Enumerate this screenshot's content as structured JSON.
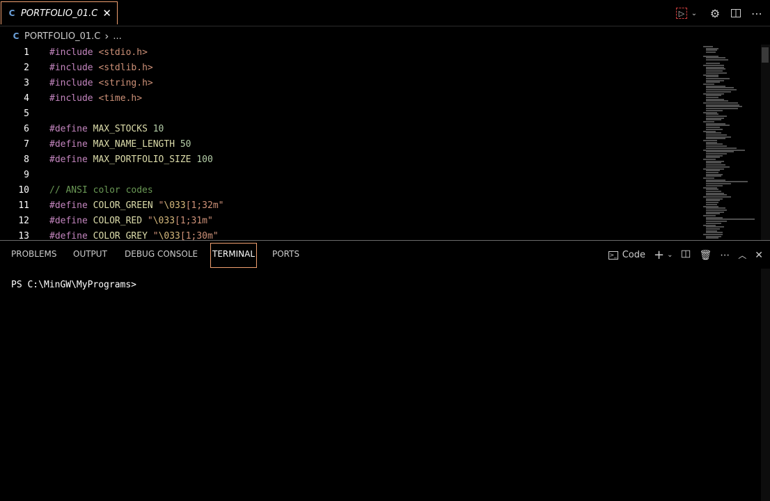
{
  "tab": {
    "icon": "c-language-icon",
    "label": "PORTFOLIO_01.C",
    "close": "✕"
  },
  "top_actions": [
    "run-icon",
    "chevron-down-icon",
    "gear-icon",
    "split-editor-icon",
    "more-icon"
  ],
  "breadcrumb": {
    "file": "PORTFOLIO_01.C",
    "sep": "›",
    "rest": "..."
  },
  "editor": {
    "lines": [
      {
        "n": "1",
        "parts": [
          [
            "kw",
            "#include"
          ],
          [
            "plain",
            " "
          ],
          [
            "inc",
            "<stdio.h>"
          ]
        ]
      },
      {
        "n": "2",
        "parts": [
          [
            "kw",
            "#include"
          ],
          [
            "plain",
            " "
          ],
          [
            "inc",
            "<stdlib.h>"
          ]
        ]
      },
      {
        "n": "3",
        "parts": [
          [
            "kw",
            "#include"
          ],
          [
            "plain",
            " "
          ],
          [
            "inc",
            "<string.h>"
          ]
        ]
      },
      {
        "n": "4",
        "parts": [
          [
            "kw",
            "#include"
          ],
          [
            "plain",
            " "
          ],
          [
            "inc",
            "<time.h>"
          ]
        ]
      },
      {
        "n": "5",
        "parts": []
      },
      {
        "n": "6",
        "parts": [
          [
            "kw",
            "#define"
          ],
          [
            "plain",
            " "
          ],
          [
            "mac",
            "MAX_STOCKS"
          ],
          [
            "plain",
            " "
          ],
          [
            "num",
            "10"
          ]
        ]
      },
      {
        "n": "7",
        "parts": [
          [
            "kw",
            "#define"
          ],
          [
            "plain",
            " "
          ],
          [
            "mac",
            "MAX_NAME_LENGTH"
          ],
          [
            "plain",
            " "
          ],
          [
            "num",
            "50"
          ]
        ]
      },
      {
        "n": "8",
        "parts": [
          [
            "kw",
            "#define"
          ],
          [
            "plain",
            " "
          ],
          [
            "mac",
            "MAX_PORTFOLIO_SIZE"
          ],
          [
            "plain",
            " "
          ],
          [
            "num",
            "100"
          ]
        ]
      },
      {
        "n": "9",
        "parts": []
      },
      {
        "n": "10",
        "parts": [
          [
            "cmt",
            "// ANSI color codes"
          ]
        ]
      },
      {
        "n": "11",
        "parts": [
          [
            "kw",
            "#define"
          ],
          [
            "plain",
            " "
          ],
          [
            "mac",
            "COLOR_GREEN"
          ],
          [
            "plain",
            " "
          ],
          [
            "str",
            "\""
          ],
          [
            "esc",
            "\\033"
          ],
          [
            "str",
            "[1;32m\""
          ]
        ]
      },
      {
        "n": "12",
        "parts": [
          [
            "kw",
            "#define"
          ],
          [
            "plain",
            " "
          ],
          [
            "mac",
            "COLOR_RED"
          ],
          [
            "plain",
            " "
          ],
          [
            "str",
            "\""
          ],
          [
            "esc",
            "\\033"
          ],
          [
            "str",
            "[1;31m\""
          ]
        ]
      },
      {
        "n": "13",
        "parts": [
          [
            "kw",
            "#define"
          ],
          [
            "plain",
            " "
          ],
          [
            "mac",
            "COLOR_GREY"
          ],
          [
            "plain",
            " "
          ],
          [
            "str",
            "\""
          ],
          [
            "esc",
            "\\033"
          ],
          [
            "str",
            "[1;30m\""
          ]
        ]
      }
    ]
  },
  "panel": {
    "tabs": [
      "PROBLEMS",
      "OUTPUT",
      "DEBUG CONSOLE",
      "TERMINAL",
      "PORTS"
    ],
    "active_tab": "TERMINAL",
    "terminal_name": "Code",
    "actions": [
      "terminal-icon",
      "plus-icon",
      "chevron-down-icon",
      "split-terminal-icon",
      "trash-icon",
      "more-icon",
      "maximize-panel-icon",
      "close-icon"
    ]
  },
  "terminal": {
    "prompt": "PS C:\\MinGW\\MyPrograms>"
  },
  "colors": {
    "background": "#000000",
    "keyword": "#c586c0",
    "string": "#ce9178",
    "macro": "#dcdcaa",
    "number": "#b5cea8",
    "comment": "#6a9955",
    "focus_border": "#f0a070"
  }
}
